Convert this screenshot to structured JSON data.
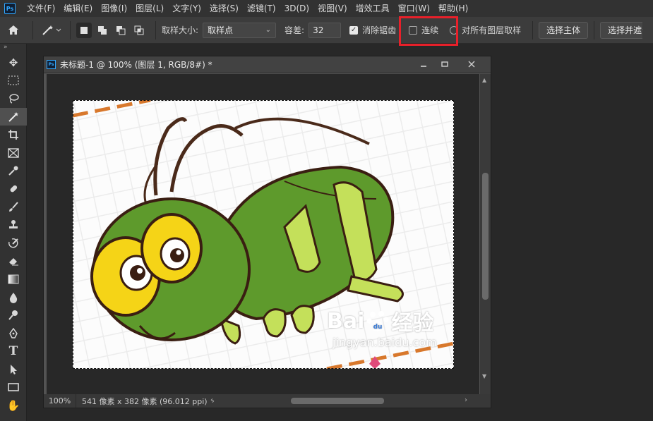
{
  "menubar": {
    "logo": "Ps",
    "items": [
      "文件(F)",
      "编辑(E)",
      "图像(I)",
      "图层(L)",
      "文字(Y)",
      "选择(S)",
      "滤镜(T)",
      "3D(D)",
      "视图(V)",
      "增效工具",
      "窗口(W)",
      "帮助(H)"
    ]
  },
  "options": {
    "sample_size_label": "取样大小:",
    "sample_size_value": "取样点",
    "tolerance_label": "容差:",
    "tolerance_value": "32",
    "anti_alias_label": "消除锯齿",
    "anti_alias_checked": true,
    "contiguous_label": "连续",
    "contiguous_checked": false,
    "sample_all_layers_label": "对所有图层取样",
    "select_subject_label": "选择主体",
    "select_and_mask_label": "选择并遮住..."
  },
  "document": {
    "icon": "Ps",
    "title": "未标题-1 @ 100% (图层 1, RGB/8#) *",
    "zoom": "100%",
    "info": "541 像素 x 382 像素 (96.012 ppi)"
  },
  "watermark": {
    "brand": "Bai",
    "brand2": "du",
    "brand3": "经验",
    "url": "jingyan.baidu.com"
  },
  "colors": {
    "highlight": "#e8202a",
    "grasshopper_body": "#5e9a2c",
    "grasshopper_leg": "#c4e05a",
    "eye_yellow": "#f5d417"
  }
}
